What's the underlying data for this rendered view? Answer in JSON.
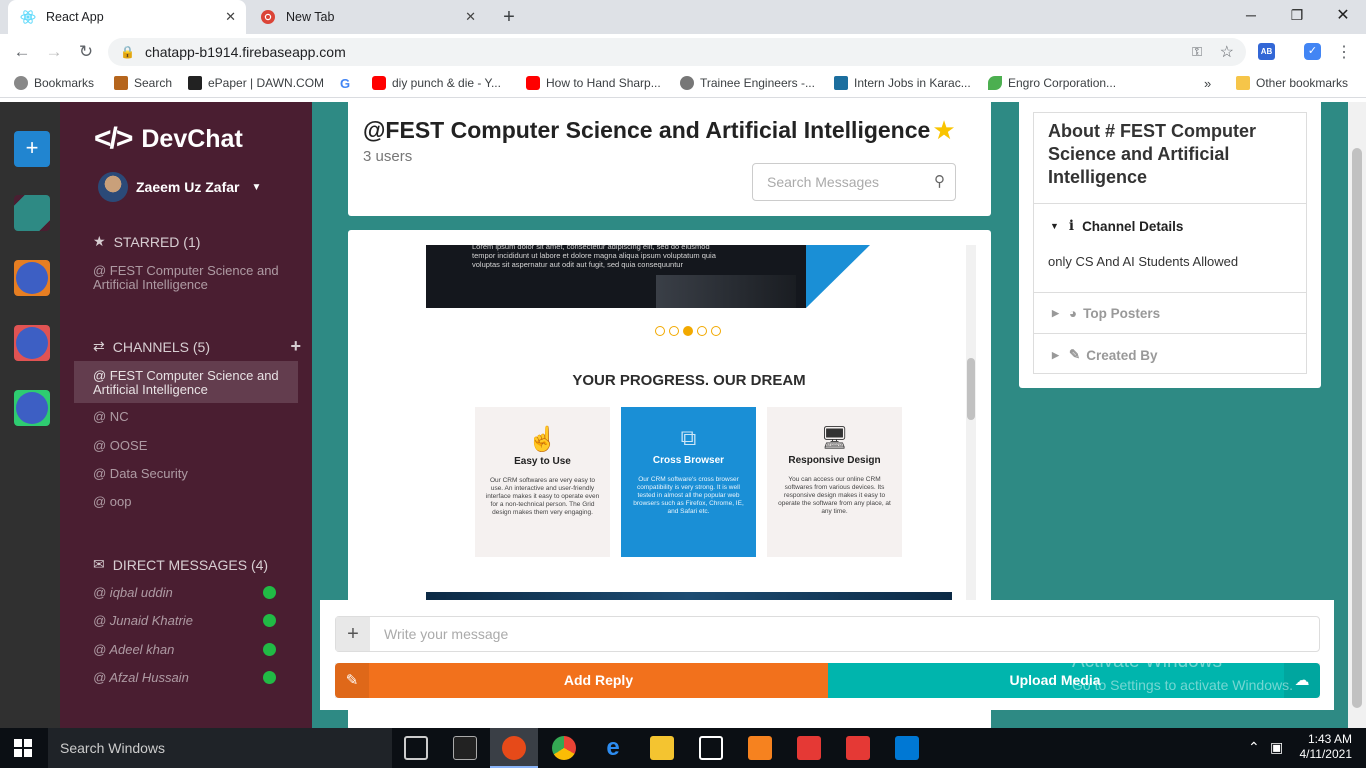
{
  "browser": {
    "tabs": [
      {
        "label": "React App",
        "active": true,
        "icon": "react-icon"
      },
      {
        "label": "New Tab",
        "active": false,
        "icon": "chrome-newtab-icon"
      }
    ],
    "url": "chatapp-b1914.firebaseapp.com",
    "bookmarks": [
      {
        "label": "Bookmarks"
      },
      {
        "label": "Search"
      },
      {
        "label": "ePaper | DAWN.COM"
      },
      {
        "label": ""
      },
      {
        "label": "diy punch & die - Y..."
      },
      {
        "label": "How to Hand Sharp..."
      },
      {
        "label": "Trainee Engineers -..."
      },
      {
        "label": "Intern Jobs in Karac..."
      },
      {
        "label": "Engro Corporation..."
      },
      {
        "label": "Other bookmarks"
      }
    ]
  },
  "sidebar": {
    "app_name": "DevChat",
    "user_name": "Zaeem Uz Zafar",
    "starred_label": "STARRED (1)",
    "starred_items": [
      "@ FEST Computer Science and Artificial Intelligence"
    ],
    "channels_label": "CHANNELS (5)",
    "channels": [
      "@ FEST Computer Science and Artificial Intelligence",
      "@ NC",
      "@ OOSE",
      "@ Data Security",
      "@ oop"
    ],
    "dm_label": "DIRECT MESSAGES (4)",
    "direct_messages": [
      "@ iqbal uddin",
      "@ Junaid Khatrie",
      "@ Adeel khan",
      "@ Afzal Hussain"
    ]
  },
  "header": {
    "channel_title": "@FEST Computer Science and Artificial Intelligence",
    "user_count": "3 users",
    "search_placeholder": "Search Messages"
  },
  "message_image": {
    "lorem": "Lorem ipsum dolor sit amet, consectetur adipiscing elit, sed do eiusmod tempor incididunt ut labore et dolore magna aliqua ipsum voluptatum quia voluptas sit aspernatur aut odit aut fugit, sed quia consequuntur",
    "heading": "YOUR PROGRESS. OUR DREAM",
    "features": [
      {
        "title": "Easy to Use",
        "text": "Our CRM softwares are very easy to use. An interactive and user-friendly interface makes it easy to operate even for a non-technical person. The Grid design makes them very engaging."
      },
      {
        "title": "Cross Browser",
        "text": "Our CRM software's cross browser compatibility is very strong. It is well tested in almost all the popular web browsers such as Firefox, Chrome, IE, and Safari etc."
      },
      {
        "title": "Responsive Design",
        "text": "You can access our online CRM softwares from various devices. Its responsive design makes it easy to operate the software from any place, at any time."
      }
    ]
  },
  "composer": {
    "placeholder": "Write your message",
    "add_reply": "Add Reply",
    "upload_media": "Upload Media"
  },
  "about_panel": {
    "title": "About # FEST Computer Science and Artificial Intelligence",
    "channel_details_label": "Channel Details",
    "channel_details_text": "only CS And AI Students Allowed",
    "top_posters_label": "Top Posters",
    "created_by_label": "Created By"
  },
  "watermark": {
    "line1": "Activate Windows",
    "line2": "Go to Settings to activate Windows."
  },
  "taskbar": {
    "search_placeholder": "Search Windows",
    "time": "1:43 AM",
    "date": "4/11/2021"
  },
  "colors": {
    "sidebar_bg": "#4a1e31",
    "main_bg": "#2e8a84",
    "add_reply": "#f2711c",
    "upload_media": "#00b5ad",
    "online": "#21ba45"
  }
}
